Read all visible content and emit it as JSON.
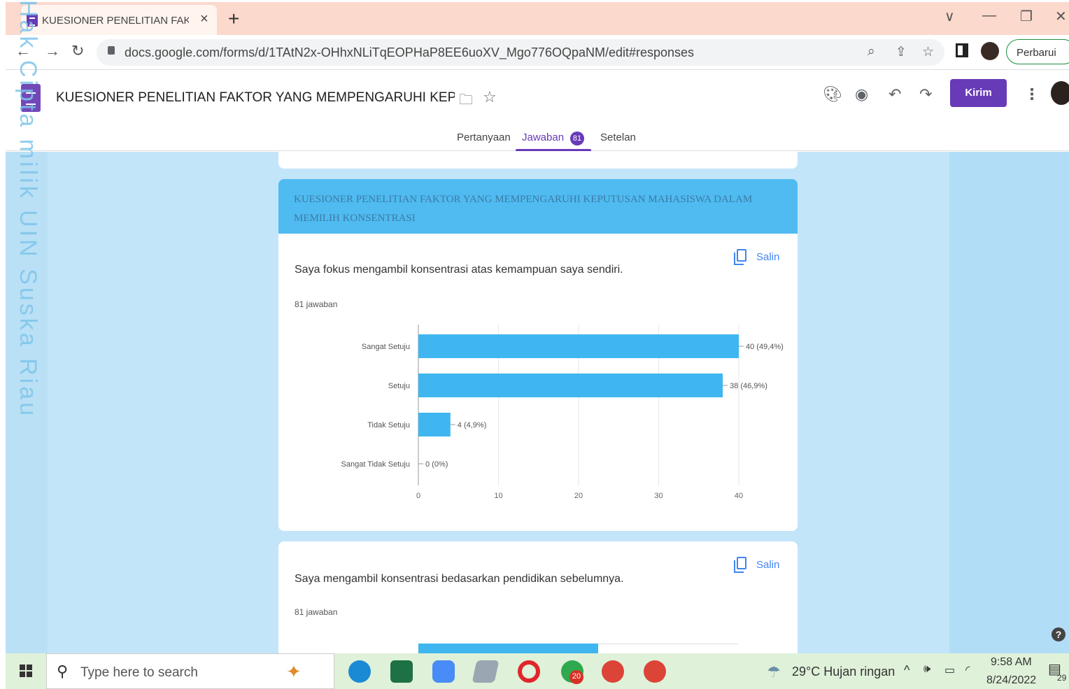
{
  "browser": {
    "tab_title": "KUESIONER PENELITIAN FAKTOR",
    "tab_close": "×",
    "new_tab": "+",
    "url": "docs.google.com/forms/d/1TAtN2x-OHhxNLiTqEOPHaP8EE6uoXV_Mgo776OQpaNM/edit#responses",
    "update_button": "Perbarui",
    "window_controls": {
      "dropdown": "∨",
      "minimize": "—",
      "restore": "❐",
      "close": "✕"
    }
  },
  "forms": {
    "title": "KUESIONER PENELITIAN FAKTOR YANG MEMPENGARUHI KEPUTUSAN MAHASISWA DALAM MEMILIH KONSENTRASI",
    "send_button": "Kirim",
    "tabs": [
      {
        "label": "Pertanyaan"
      },
      {
        "label": "Jawaban",
        "badge": "81"
      },
      {
        "label": "Setelan"
      }
    ]
  },
  "watermark": "Hak Cipta milik UIN Suska Riau",
  "section_header": "KUESIONER PENELITIAN FAKTOR YANG MEMPENGARUHI KEPUTUSAN MAHASISWA DALAM MEMILIH KONSENTRASI",
  "questions": [
    {
      "title": "Saya fokus mengambil konsentrasi atas kemampuan saya sendiri.",
      "count": "81 jawaban",
      "copy_label": "Salin"
    },
    {
      "title": "Saya mengambil konsentrasi bedasarkan pendidikan sebelumnya.",
      "count": "81 jawaban",
      "copy_label": "Salin"
    }
  ],
  "chart_data": [
    {
      "type": "bar",
      "orientation": "horizontal",
      "categories": [
        "Sangat Setuju",
        "Setuju",
        "Tidak Setuju",
        "Sangat Tidak Setuju"
      ],
      "values": [
        40,
        38,
        4,
        0
      ],
      "data_labels": [
        "40 (49,4%)",
        "38 (46,9%)",
        "4 (4,9%)",
        "0 (0%)"
      ],
      "xticks": [
        "0",
        "10",
        "20",
        "30",
        "40"
      ],
      "xlim": [
        0,
        40
      ],
      "grid": true,
      "color": "#3fb6ef"
    }
  ],
  "taskbar": {
    "search_placeholder": "Type here to search",
    "weather": "29°C  Hujan ringan",
    "time": "9:58 AM",
    "date": "8/24/2022",
    "notification_count": "29",
    "badge_count": "20"
  },
  "help": "?"
}
